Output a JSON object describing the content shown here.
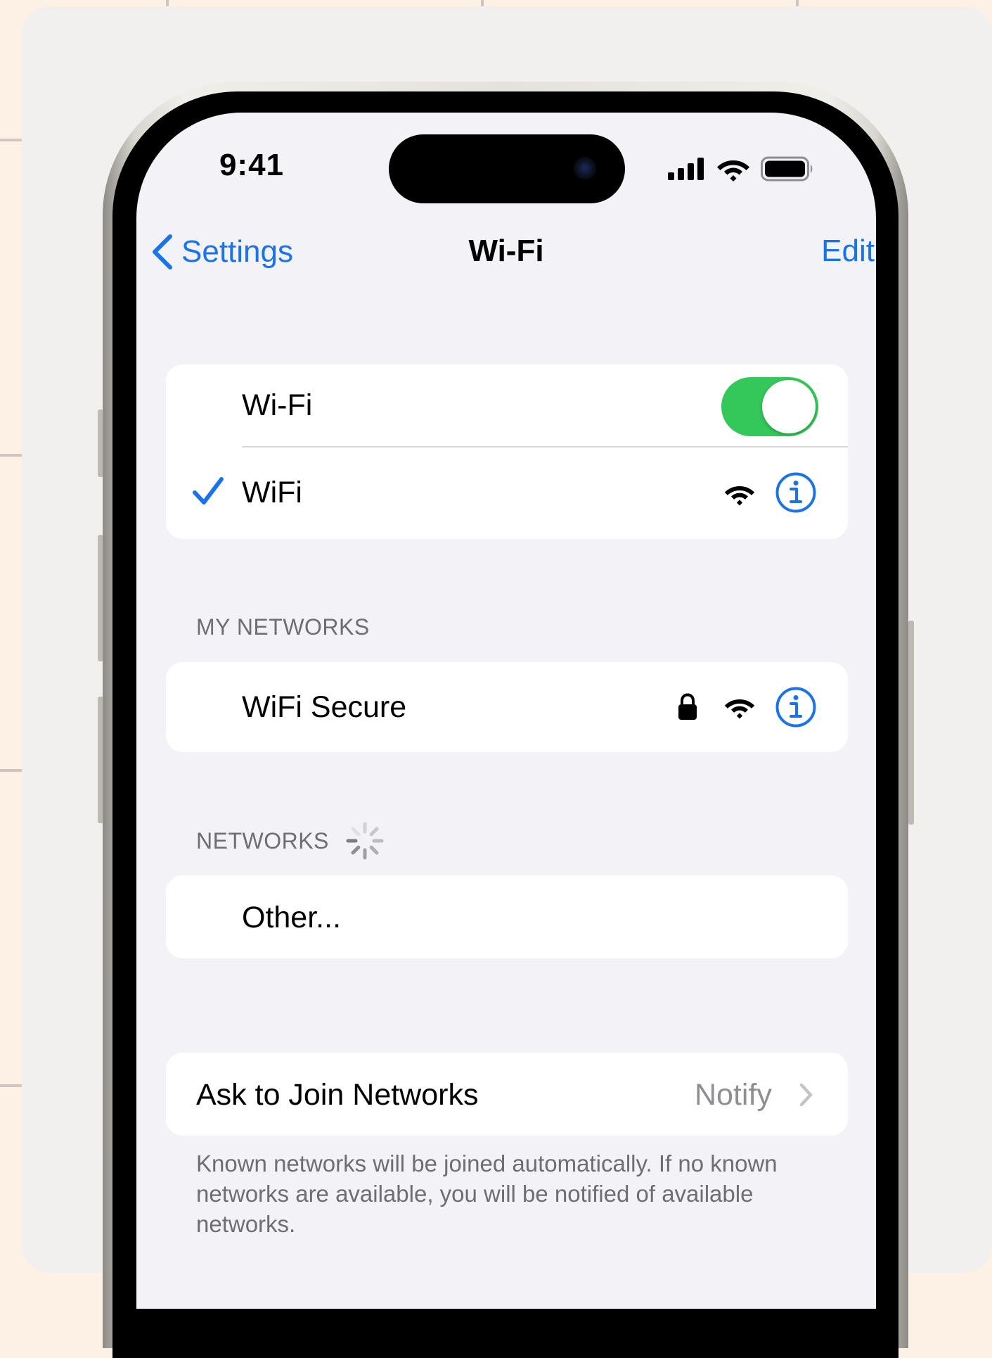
{
  "status_bar": {
    "time": "9:41"
  },
  "nav": {
    "back_label": "Settings",
    "title": "Wi-Fi",
    "edit_label": "Edit"
  },
  "wifi_group": {
    "toggle_label": "Wi-Fi",
    "toggle_on": true,
    "connected_network": "WiFi"
  },
  "my_networks": {
    "header": "MY NETWORKS",
    "items": [
      {
        "name": "WiFi Secure",
        "secured": true
      }
    ]
  },
  "networks": {
    "header": "NETWORKS",
    "other_label": "Other..."
  },
  "ask_to_join": {
    "label": "Ask to Join Networks",
    "value": "Notify",
    "footnote": "Known networks will be joined automatically. If no known networks are available, you will be notified of available networks."
  },
  "colors": {
    "accent": "#1a73e8",
    "toggle_on": "#34c759",
    "background": "#f2f2f7"
  }
}
